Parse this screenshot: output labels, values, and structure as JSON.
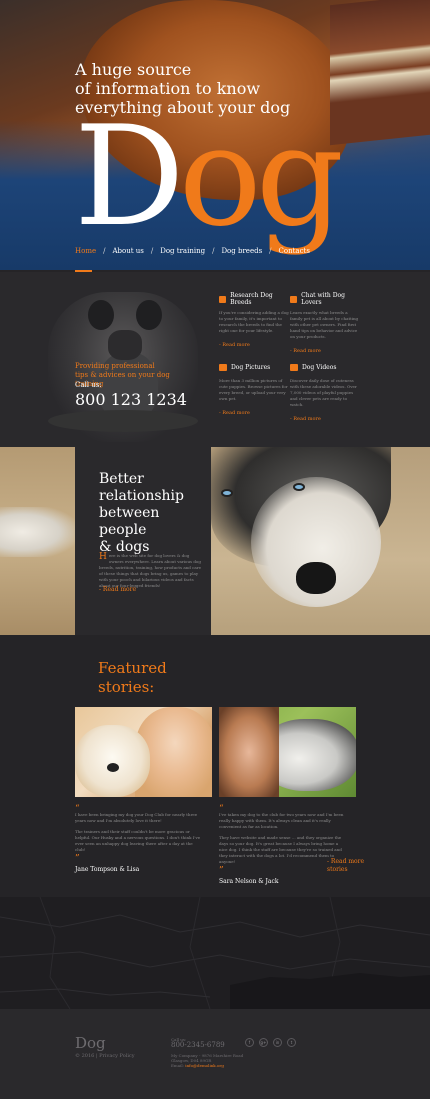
{
  "hero": {
    "tagline_line1": "A huge source",
    "tagline_line2": "of information to know",
    "tagline_line3": "everything about your dog",
    "big_d": "D",
    "big_og": "og"
  },
  "nav": {
    "items": [
      {
        "label": "Home"
      },
      {
        "label": "About us"
      },
      {
        "label": "Dog training"
      },
      {
        "label": "Dog breeds"
      },
      {
        "label": "Contacts"
      }
    ],
    "separator": "/",
    "active_index": 0
  },
  "contact_block": {
    "providing_line1": "Providing professional",
    "providing_line2": "tips & advices on your dog training",
    "call_label": "Call us:",
    "phone": "800 123 1234"
  },
  "features": [
    {
      "title": "Research Dog Breeds",
      "text": "If you're considering adding a dog to your family, it's important to research the breeds to find the right one for your lifestyle.",
      "more": "- Read more"
    },
    {
      "title": "Chat with Dog Lovers",
      "text": "Learn exactly what breeds a family pet is all about by chatting with other pet owners. Find first hand tips on behavior and advice on your products.",
      "more": "- Read more"
    },
    {
      "title": "Dog Pictures",
      "text": "More than 3 million pictures of cute puppies. Browse pictures for every breed, or upload your very own pet.",
      "more": "- Read more"
    },
    {
      "title": "Dog Videos",
      "text": "Discover daily dose of cuteness with these adorable videos. Over 7,000 videos of playful puppies and clever pets are ready to watch.",
      "more": "- Read more"
    }
  ],
  "relationship": {
    "title_line1": "Better",
    "title_line2": "relationship",
    "title_line3": "between people",
    "title_line4": "& dogs",
    "dropcap": "H",
    "text": "ere is the web site for dog lovers & dog owners everywhere. Learn about various dog breeds, nutrition, training, how products and care of these things that dogs bring us, games to play with your pooch and hilarious videos and facts about our four-legged friends!",
    "more": "- Read more"
  },
  "featured": {
    "title_line1": "Featured",
    "title_line2": "stories:",
    "stories": [
      {
        "open_quote": "“",
        "text": "I have been bringing my dog your Dog Club for nearly three years now and I'm absolutely love it there!",
        "text2": "The trainers and their staff couldn't be more gracious or helpful. Our Husky and a nervous questions. I don't think I've ever seen an unhappy dog leaving there after a day at the club!",
        "close_quote": "”",
        "name": "Jane Tompson & Lisa"
      },
      {
        "open_quote": "“",
        "text": "I've taken my dog to the club for two years now and I'm been really happy with them. It's always clean and it's really convenient as far as location.",
        "text2": "They have website and made sense ... and they organize the days so your dog. It's great because I always bring home a nice dog. I think the staff are because they're so trained and they interact with the dogs a lot. I'd recommend them to anyone!",
        "close_quote": "”",
        "name": "Sara Nelson & Jack"
      }
    ],
    "read_more": "- Read more stories"
  },
  "footer": {
    "logo": "Dog",
    "copyright": "© 2016 | Privacy Policy",
    "fax_label": "Call us:",
    "phone": "800-2345-6789",
    "address_line1": "My Company - 9876 Marshire Road",
    "address_line2": "Glasgow, D04 89GR",
    "email_label": "Email:",
    "email": "info@demolink.org",
    "social": [
      {
        "icon": "facebook-icon",
        "glyph": "f"
      },
      {
        "icon": "google-plus-icon",
        "glyph": "g+"
      },
      {
        "icon": "linkedin-icon",
        "glyph": "in"
      },
      {
        "icon": "twitter-icon",
        "glyph": "t"
      }
    ]
  },
  "colors": {
    "accent": "#f07a1a",
    "background": "#252427",
    "panel": "#2a292c"
  }
}
